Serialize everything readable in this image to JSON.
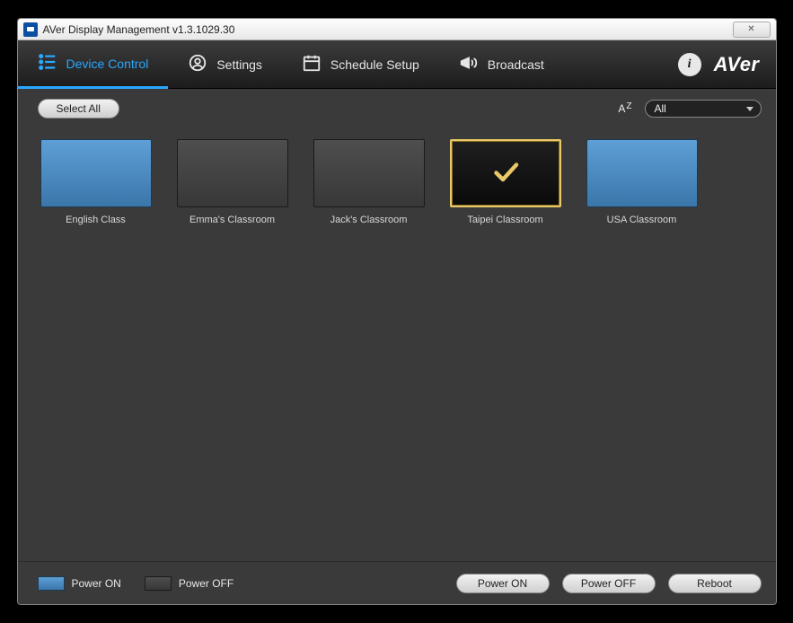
{
  "window": {
    "title": "AVer Display Management v1.3.1029.30",
    "close_glyph": "✕"
  },
  "nav": {
    "items": [
      {
        "label": "Device Control",
        "active": true
      },
      {
        "label": "Settings",
        "active": false
      },
      {
        "label": "Schedule Setup",
        "active": false
      },
      {
        "label": "Broadcast",
        "active": false
      }
    ],
    "brand": "AVer"
  },
  "toolbar": {
    "select_all": "Select All",
    "sort_label_a": "A",
    "sort_label_z": "Z",
    "filter_selected": "All"
  },
  "devices": [
    {
      "name": "English Class",
      "state": "on",
      "selected": false
    },
    {
      "name": "Emma's Classroom",
      "state": "off",
      "selected": false
    },
    {
      "name": "Jack's Classroom",
      "state": "off",
      "selected": false
    },
    {
      "name": "Taipei Classroom",
      "state": "off",
      "selected": true
    },
    {
      "name": "USA Classroom",
      "state": "on",
      "selected": false
    }
  ],
  "legend": {
    "on": "Power ON",
    "off": "Power OFF"
  },
  "actions": {
    "power_on": "Power ON",
    "power_off": "Power OFF",
    "reboot": "Reboot"
  }
}
